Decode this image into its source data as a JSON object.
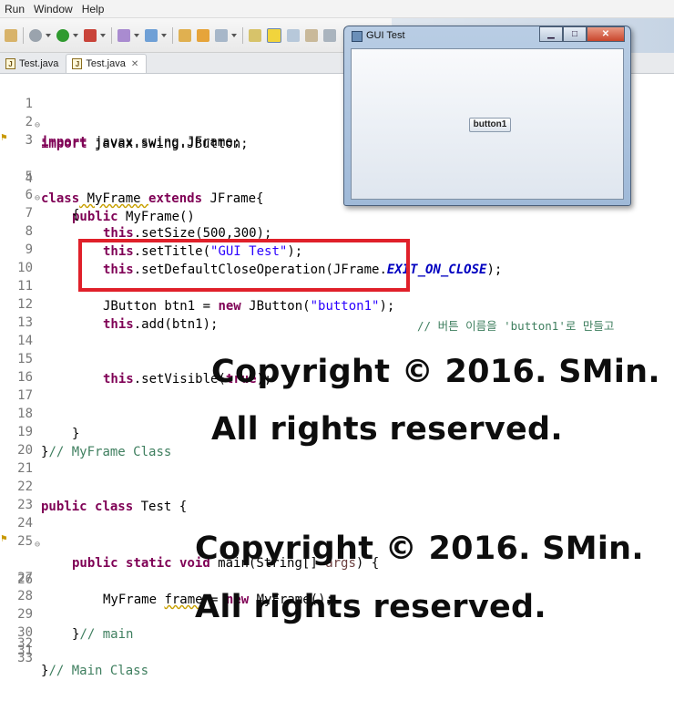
{
  "menu": [
    "Run",
    "Window",
    "Help"
  ],
  "tabs": [
    {
      "label": "Test.java",
      "active": false
    },
    {
      "label": "Test.java",
      "active": true
    }
  ],
  "gui_window": {
    "title": "GUI Test",
    "button_label": "button1"
  },
  "code": {
    "l1": {
      "num": "1",
      "a": "import",
      "b": " javax.swing.JButton;"
    },
    "l2": {
      "num": "2",
      "a": "import",
      "b": " javax.swing.JFrame;"
    },
    "l3": {
      "num": "3"
    },
    "l4": {
      "num": "4",
      "a": "class",
      "b": " MyFrame ",
      "c": "extends",
      "d": " JFrame{"
    },
    "l5": {
      "num": "5",
      "a": "public",
      "b": " MyFrame()"
    },
    "l6": {
      "num": "6",
      "a": "{"
    },
    "l7": {
      "num": "7",
      "a": "this",
      "b": ".setSize(500,300);"
    },
    "l8": {
      "num": "8",
      "a": "this",
      "b": ".setTitle(",
      "c": "\"GUI Test\"",
      "d": ");"
    },
    "l9": {
      "num": "9",
      "a": "this",
      "b": ".setDefaultCloseOperation(JFrame.",
      "c": "EXIT_ON_CLOSE",
      "d": ");"
    },
    "l10": {
      "num": "10"
    },
    "l11": {
      "num": "11",
      "a": "JButton btn1 = ",
      "b": "new",
      "c": " JButton(",
      "d": "\"button1\"",
      "e": ");",
      "f": "// 버튼 이름을 'button1'로 만들고"
    },
    "l12": {
      "num": "12",
      "a": "this",
      "b": ".add(btn1);"
    },
    "l13": {
      "num": "13"
    },
    "l14": {
      "num": "14"
    },
    "l15": {
      "num": "15",
      "a": "this",
      "b": ".setVisible(",
      "c": "true",
      "d": ");"
    },
    "l16": {
      "num": "16"
    },
    "l17": {
      "num": "17"
    },
    "l18": {
      "num": "18",
      "a": "}"
    },
    "l19": {
      "num": "19",
      "a": "}",
      "b": "// MyFrame Class"
    },
    "l20": {
      "num": "20"
    },
    "l21": {
      "num": "21"
    },
    "l22": {
      "num": "22",
      "a": "public",
      "b": " ",
      "c": "class",
      "d": " Test {"
    },
    "l23": {
      "num": "23"
    },
    "l24": {
      "num": "24",
      "a": "public",
      "b": "static",
      "c": "void",
      "d": " main(String[] ",
      "e": "args",
      "f": ") {"
    },
    "l25": {
      "num": "25"
    },
    "l26": {
      "num": "26",
      "a": "MyFrame ",
      "b": "frame",
      "c": " = ",
      "d": "new",
      "e": " MyFrame();"
    },
    "l27": {
      "num": "27"
    },
    "l28": {
      "num": "28"
    },
    "l29": {
      "num": "29",
      "a": "}",
      "b": "// main"
    },
    "l30": {
      "num": "30"
    },
    "l31": {
      "num": "31",
      "a": "}",
      "b": "// Main Class"
    },
    "l32": {
      "num": "32"
    },
    "l33": {
      "num": "33"
    }
  },
  "watermarks": [
    "Copyright © 2016. SMin.",
    "All rights reserved.",
    "Copyright © 2016. SMin.",
    "All rights reserved."
  ],
  "colors": {
    "highlight_box": "#e0202a",
    "keyword": "#7f0055",
    "string": "#2a00ff",
    "comment": "#3f7f5f"
  }
}
